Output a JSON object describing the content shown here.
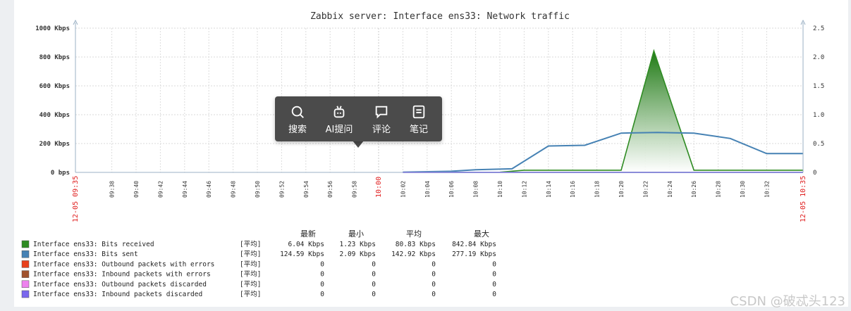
{
  "chart_data": {
    "type": "area",
    "title": "Zabbix server: Interface ens33: Network traffic",
    "left_axis": {
      "ylim": [
        0,
        1000
      ],
      "ticks": [
        {
          "value": 0,
          "label": "0 bps"
        },
        {
          "value": 200,
          "label": "200 Kbps"
        },
        {
          "value": 400,
          "label": "400 Kbps"
        },
        {
          "value": 600,
          "label": "600 Kbps"
        },
        {
          "value": 800,
          "label": "800 Kbps"
        },
        {
          "value": 1000,
          "label": "1000 Kbps"
        }
      ]
    },
    "right_axis": {
      "ylim": [
        0,
        2.5
      ],
      "ticks": [
        {
          "value": 0,
          "label": "0"
        },
        {
          "value": 0.5,
          "label": "0.5"
        },
        {
          "value": 1.0,
          "label": "1.0"
        },
        {
          "value": 1.5,
          "label": "1.5"
        },
        {
          "value": 2.0,
          "label": "2.0"
        },
        {
          "value": 2.5,
          "label": "2.5"
        }
      ]
    },
    "x_range": [
      "09:35",
      "10:35"
    ],
    "x_ticks": [
      {
        "t": "09:35",
        "label": "12-05 09:35",
        "major": true
      },
      {
        "t": "09:38",
        "label": "09:38",
        "major": false
      },
      {
        "t": "09:40",
        "label": "09:40",
        "major": false
      },
      {
        "t": "09:42",
        "label": "09:42",
        "major": false
      },
      {
        "t": "09:44",
        "label": "09:44",
        "major": false
      },
      {
        "t": "09:46",
        "label": "09:46",
        "major": false
      },
      {
        "t": "09:48",
        "label": "09:48",
        "major": false
      },
      {
        "t": "09:50",
        "label": "09:50",
        "major": false
      },
      {
        "t": "09:52",
        "label": "09:52",
        "major": false
      },
      {
        "t": "09:54",
        "label": "09:54",
        "major": false
      },
      {
        "t": "09:56",
        "label": "09:56",
        "major": false
      },
      {
        "t": "09:58",
        "label": "09:58",
        "major": false
      },
      {
        "t": "10:00",
        "label": "10:00",
        "major": true
      },
      {
        "t": "10:02",
        "label": "10:02",
        "major": false
      },
      {
        "t": "10:04",
        "label": "10:04",
        "major": false
      },
      {
        "t": "10:06",
        "label": "10:06",
        "major": false
      },
      {
        "t": "10:08",
        "label": "10:08",
        "major": false
      },
      {
        "t": "10:10",
        "label": "10:10",
        "major": false
      },
      {
        "t": "10:12",
        "label": "10:12",
        "major": false
      },
      {
        "t": "10:14",
        "label": "10:14",
        "major": false
      },
      {
        "t": "10:16",
        "label": "10:16",
        "major": false
      },
      {
        "t": "10:18",
        "label": "10:18",
        "major": false
      },
      {
        "t": "10:20",
        "label": "10:20",
        "major": false
      },
      {
        "t": "10:22",
        "label": "10:22",
        "major": false
      },
      {
        "t": "10:24",
        "label": "10:24",
        "major": false
      },
      {
        "t": "10:26",
        "label": "10:26",
        "major": false
      },
      {
        "t": "10:28",
        "label": "10:28",
        "major": false
      },
      {
        "t": "10:30",
        "label": "10:30",
        "major": false
      },
      {
        "t": "10:32",
        "label": "10:32",
        "major": false
      },
      {
        "t": "10:35",
        "label": "12-05 10:35",
        "major": true
      }
    ],
    "grid": true,
    "series": [
      {
        "name": "Interface ens33: Bits received",
        "color": "#2e8b22",
        "style": "filled",
        "points": [
          [
            "10:02",
            1.2
          ],
          [
            "10:10",
            1.5
          ],
          [
            "10:12",
            15
          ],
          [
            "10:20",
            15
          ],
          [
            "10:22.7",
            842.84
          ],
          [
            "10:26",
            15
          ],
          [
            "10:35",
            15
          ]
        ]
      },
      {
        "name": "Interface ens33: Bits sent",
        "color": "#4682b4",
        "style": "line",
        "points": [
          [
            "10:02",
            2.09
          ],
          [
            "10:06",
            8
          ],
          [
            "10:08",
            18
          ],
          [
            "10:11",
            25
          ],
          [
            "10:14",
            183
          ],
          [
            "10:17",
            188
          ],
          [
            "10:20",
            272
          ],
          [
            "10:23",
            277.19
          ],
          [
            "10:26",
            272
          ],
          [
            "10:29",
            235
          ],
          [
            "10:32",
            130
          ],
          [
            "10:35",
            130
          ]
        ]
      },
      {
        "name": "Interface ens33: Outbound packets with errors",
        "color": "#e8401c",
        "style": "line",
        "points": []
      },
      {
        "name": "Interface ens33: Inbound packets with errors",
        "color": "#a0522d",
        "style": "line",
        "points": []
      },
      {
        "name": "Interface ens33: Outbound packets discarded",
        "color": "#ee82ee",
        "style": "line",
        "points": []
      },
      {
        "name": "Interface ens33: Inbound packets discarded",
        "color": "#7b68ee",
        "style": "line",
        "points": [
          [
            "10:02",
            0
          ],
          [
            "10:35",
            0
          ]
        ]
      }
    ],
    "legend": {
      "columns": [
        "最新",
        "最小",
        "平均",
        "最大"
      ],
      "rows": [
        {
          "name": "Interface ens33: Bits received",
          "func": "[平均]",
          "last": "6.04 Kbps",
          "min": "1.23 Kbps",
          "avg": "80.83 Kbps",
          "max": "842.84 Kbps"
        },
        {
          "name": "Interface ens33: Bits sent",
          "func": "[平均]",
          "last": "124.59 Kbps",
          "min": "2.09 Kbps",
          "avg": "142.92 Kbps",
          "max": "277.19 Kbps"
        },
        {
          "name": "Interface ens33: Outbound packets with errors",
          "func": "[平均]",
          "last": "0",
          "min": "0",
          "avg": "0",
          "max": "0"
        },
        {
          "name": "Interface ens33: Inbound packets with errors",
          "func": "[平均]",
          "last": "0",
          "min": "0",
          "avg": "0",
          "max": "0"
        },
        {
          "name": "Interface ens33: Outbound packets discarded",
          "func": "[平均]",
          "last": "0",
          "min": "0",
          "avg": "0",
          "max": "0"
        },
        {
          "name": "Interface ens33: Inbound packets discarded",
          "func": "[平均]",
          "last": "0",
          "min": "0",
          "avg": "0",
          "max": "0"
        }
      ]
    }
  },
  "toolbar": {
    "items": [
      {
        "label": "搜索",
        "icon": "search-icon"
      },
      {
        "label": "AI提问",
        "icon": "robot-icon"
      },
      {
        "label": "评论",
        "icon": "comment-icon"
      },
      {
        "label": "笔记",
        "icon": "note-icon"
      }
    ]
  },
  "watermark": "CSDN @破忒头123"
}
